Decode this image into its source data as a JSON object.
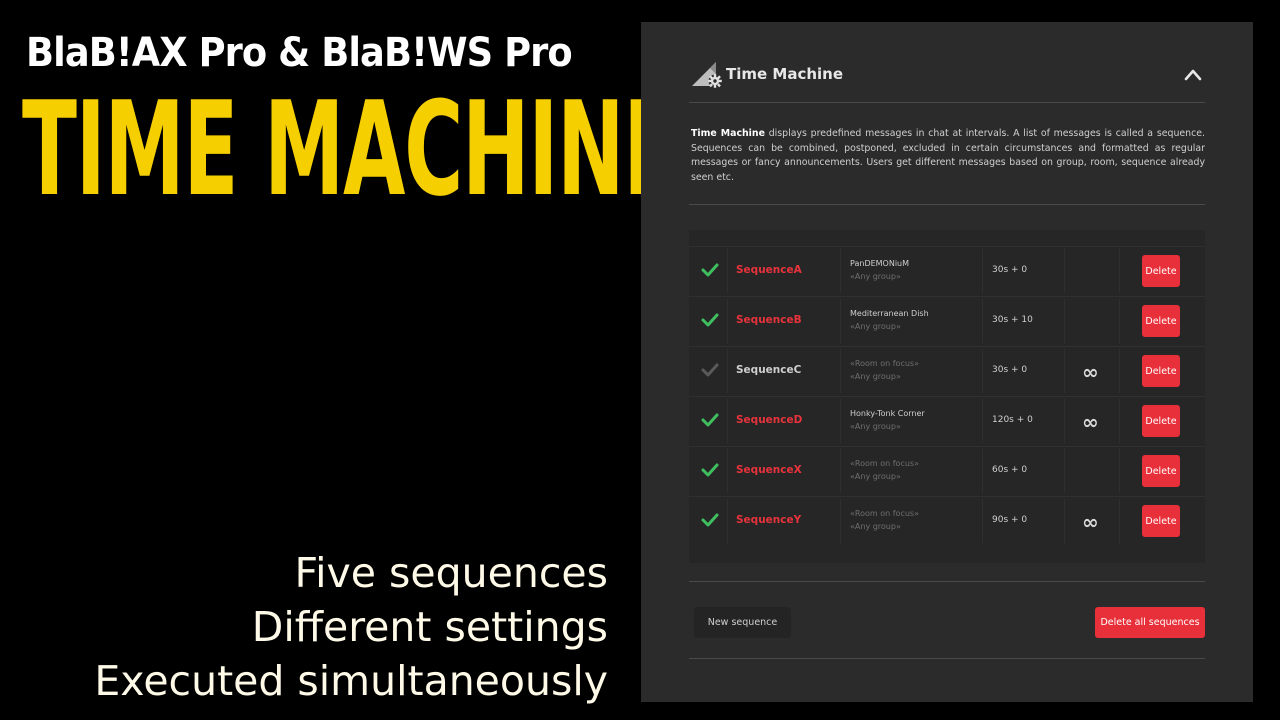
{
  "promo": {
    "subtitle": "BlaB!AX Pro & BlaB!WS Pro",
    "title": "TIME MACHINE",
    "taglines": [
      "Five sequences",
      "Different settings",
      "Executed simultaneously"
    ]
  },
  "panel": {
    "title": "Time Machine",
    "icon": "time-machine-gear-icon",
    "collapse_icon": "chevron-up-icon",
    "description_bold": "Time Machine",
    "description_rest": " displays predefined messages in chat at intervals. A list of messages is called a sequence. Sequences can be combined, postponed, excluded in certain circumstances and formatted as regular messages or fancy announcements. Users get different messages based on group, room, sequence already seen etc.",
    "sequences": [
      {
        "name": "SequenceA",
        "active": true,
        "room": "PanDEMONiuM",
        "room_muted": false,
        "group": "«Any group»",
        "interval": "30s + 0",
        "loop": "",
        "delete_label": "Delete"
      },
      {
        "name": "SequenceB",
        "active": true,
        "room": "Mediterranean Dish",
        "room_muted": false,
        "group": "«Any group»",
        "interval": "30s + 10",
        "loop": "",
        "delete_label": "Delete"
      },
      {
        "name": "SequenceC",
        "active": false,
        "room": "«Room on focus»",
        "room_muted": true,
        "group": "«Any group»",
        "interval": "30s + 0",
        "loop": "∞",
        "delete_label": "Delete"
      },
      {
        "name": "SequenceD",
        "active": true,
        "room": "Honky-Tonk Corner",
        "room_muted": false,
        "group": "«Any group»",
        "interval": "120s + 0",
        "loop": "∞",
        "delete_label": "Delete"
      },
      {
        "name": "SequenceX",
        "active": true,
        "room": "«Room on focus»",
        "room_muted": true,
        "group": "«Any group»",
        "interval": "60s + 0",
        "loop": "",
        "delete_label": "Delete"
      },
      {
        "name": "SequenceY",
        "active": true,
        "room": "«Room on focus»",
        "room_muted": true,
        "group": "«Any group»",
        "interval": "90s + 0",
        "loop": "∞",
        "delete_label": "Delete"
      }
    ],
    "new_sequence_label": "New sequence",
    "delete_all_label": "Delete all sequences"
  },
  "colors": {
    "accent_yellow": "#f5cf00",
    "active_name": "#e8333c",
    "inactive_name": "#cfcfcf",
    "check_active": "#3fbf5f",
    "check_inactive": "#5a5a5a",
    "delete_red": "#e8303a"
  }
}
